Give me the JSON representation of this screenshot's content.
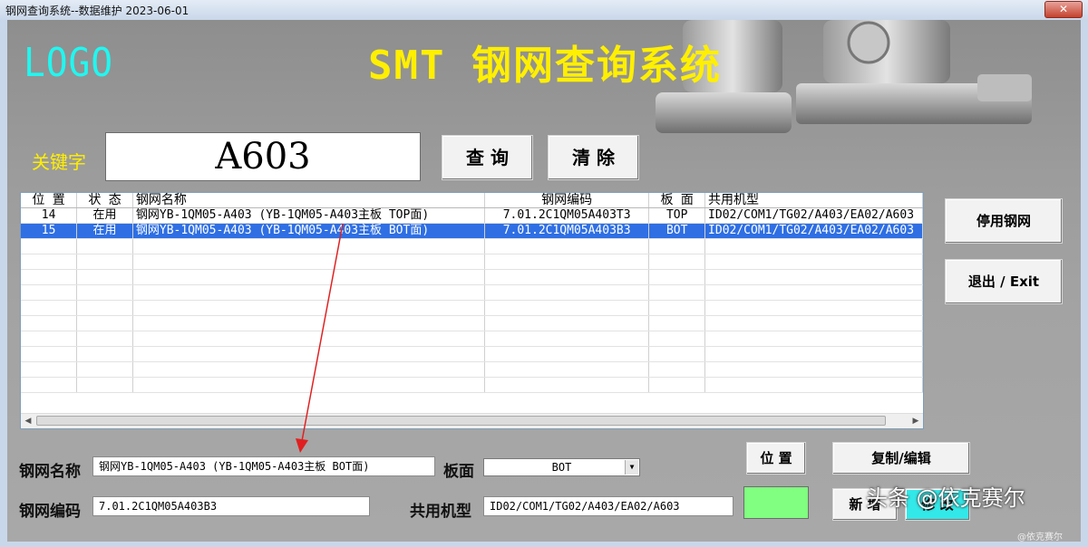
{
  "window": {
    "title": "钢网查询系统--数据维护 2023-06-01"
  },
  "header": {
    "logo": "LOGO",
    "app_title": "SMT 钢网查询系统"
  },
  "search": {
    "label": "关键字",
    "value": "A603",
    "query_button": "查 询",
    "clear_button": "清 除"
  },
  "side_buttons": {
    "disable": "停用钢网",
    "exit": "退出 / Exit"
  },
  "table": {
    "columns": [
      "位 置",
      "状 态",
      "钢网名称",
      "钢网编码",
      "板 面",
      "共用机型"
    ],
    "rows": [
      {
        "pos": "14",
        "status": "在用",
        "name": "钢网YB-1QM05-A403 (YB-1QM05-A403主板 TOP面)",
        "code": "7.01.2C1QM05A403T3",
        "side": "TOP",
        "models": "ID02/COM1/TG02/A403/EA02/A603",
        "selected": false
      },
      {
        "pos": "15",
        "status": "在用",
        "name": "钢网YB-1QM05-A403 (YB-1QM05-A403主板 BOT面)",
        "code": "7.01.2C1QM05A403B3",
        "side": "BOT",
        "models": "ID02/COM1/TG02/A403/EA02/A603",
        "selected": true
      }
    ]
  },
  "form": {
    "name_label": "钢网名称",
    "name_value": "钢网YB-1QM05-A403 (YB-1QM05-A403主板 BOT面)",
    "side_label": "板面",
    "side_value": "BOT",
    "code_label": "钢网编码",
    "code_value": "7.01.2C1QM05A403B3",
    "models_label": "共用机型",
    "models_value": "ID02/COM1/TG02/A403/EA02/A603"
  },
  "actions": {
    "position": "位 置",
    "copy_edit": "复制/编辑",
    "add": "新 增",
    "modify": "修 改"
  },
  "colors": {
    "accent_yellow": "#ffef00",
    "logo_cyan": "#20f7f0",
    "selection_blue": "#2f6fe3",
    "swatch_green": "#80ff80",
    "modify_cyan": "#33e8e8"
  },
  "watermark": {
    "text": "头条 @依克赛尔",
    "small": "@依克赛尔"
  }
}
